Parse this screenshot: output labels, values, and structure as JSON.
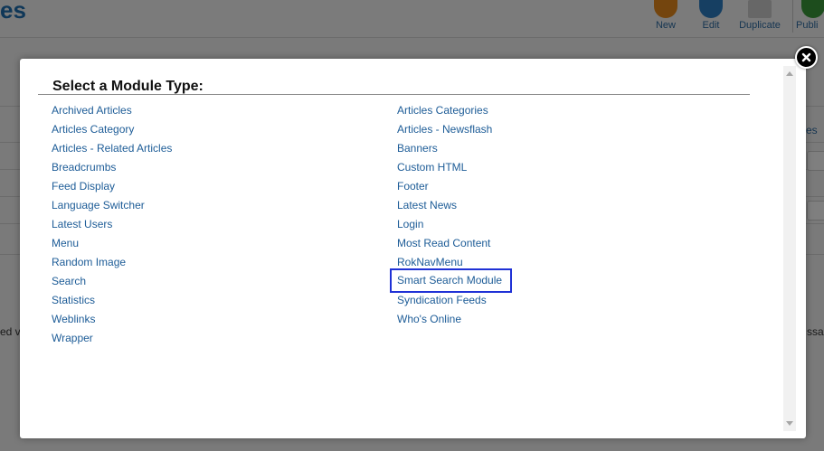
{
  "background": {
    "page_title": "es",
    "toolbar": [
      {
        "label": "New",
        "icon": "new-icon",
        "color": "#e88b1c"
      },
      {
        "label": "Edit",
        "icon": "edit-icon",
        "color": "#2d7fc5"
      },
      {
        "label": "Duplicate",
        "icon": "duplicate-icon",
        "color": "#9a9a9a"
      },
      {
        "label": "Publi",
        "icon": "publish-icon",
        "color": "#3a9a3a"
      }
    ],
    "side_link_right": "es",
    "side_text_left": "ed v",
    "side_text_right": "ssar"
  },
  "modal": {
    "heading": "Select a Module Type:",
    "close_icon": "close-icon",
    "left_column": [
      "Archived Articles",
      "Articles Category",
      "Articles - Related Articles",
      "Breadcrumbs",
      "Feed Display",
      "Language Switcher",
      "Latest Users",
      "Menu",
      "Random Image",
      "Search",
      "Statistics",
      "Weblinks",
      "Wrapper"
    ],
    "right_column": [
      "Articles Categories",
      "Articles - Newsflash",
      "Banners",
      "Custom HTML",
      "Footer",
      "Latest News",
      "Login",
      "Most Read Content",
      "RokNavMenu",
      "Smart Search Module",
      "Syndication Feeds",
      "Who's Online"
    ],
    "highlighted_item": "Smart Search Module",
    "highlight_color": "#1f31d6",
    "link_color": "#1d5c97"
  }
}
